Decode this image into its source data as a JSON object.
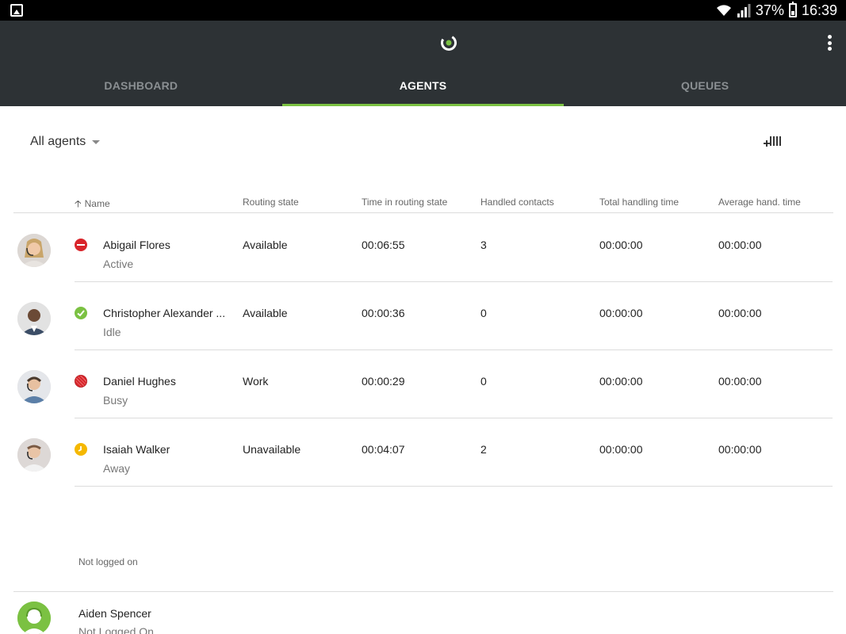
{
  "status_bar": {
    "battery": "37%",
    "time": "16:39"
  },
  "tabs": [
    {
      "label": "DASHBOARD"
    },
    {
      "label": "AGENTS"
    },
    {
      "label": "QUEUES"
    }
  ],
  "filter": {
    "label": "All agents"
  },
  "columns": {
    "name": "Name",
    "routing_state": "Routing state",
    "time_in_state": "Time in routing state",
    "handled": "Handled contacts",
    "total_time": "Total handling time",
    "avg_time": "Average hand. time"
  },
  "agents": [
    {
      "name": "Abigail Flores",
      "presence": "Active",
      "routing_state": "Available",
      "time_in_state": "00:06:55",
      "handled": "3",
      "total_time": "00:00:00",
      "avg_time": "00:00:00",
      "status_icon": "do-not-disturb-icon"
    },
    {
      "name": "Christopher Alexander ...",
      "presence": "Idle",
      "routing_state": "Available",
      "time_in_state": "00:00:36",
      "handled": "0",
      "total_time": "00:00:00",
      "avg_time": "00:00:00",
      "status_icon": "check-icon"
    },
    {
      "name": "Daniel Hughes",
      "presence": "Busy",
      "routing_state": "Work",
      "time_in_state": "00:00:29",
      "handled": "0",
      "total_time": "00:00:00",
      "avg_time": "00:00:00",
      "status_icon": "busy-icon"
    },
    {
      "name": "Isaiah Walker",
      "presence": "Away",
      "routing_state": "Unavailable",
      "time_in_state": "00:04:07",
      "handled": "2",
      "total_time": "00:00:00",
      "avg_time": "00:00:00",
      "status_icon": "clock-icon"
    }
  ],
  "not_logged": {
    "section_label": "Not logged on",
    "agents": [
      {
        "name": "Aiden Spencer",
        "presence": "Not Logged On"
      }
    ]
  },
  "colors": {
    "appbar": "#2d3235",
    "accent": "#7bc142",
    "red": "#d9252b",
    "yellow": "#f5b800"
  }
}
